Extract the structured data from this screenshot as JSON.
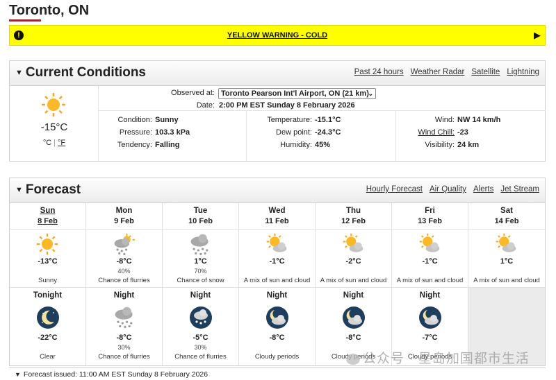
{
  "location": "Toronto, ON",
  "warning": {
    "text": "YELLOW WARNING - COLD",
    "color": "#ffff00"
  },
  "current": {
    "title": "Current Conditions",
    "links": [
      "Past 24 hours",
      "Weather Radar",
      "Satellite",
      "Lightning"
    ],
    "temp": "-15°C",
    "unit_c": "°C",
    "unit_f": "°F",
    "observed_label": "Observed at:",
    "observed_station": "Toronto Pearson Int'l Airport, ON (21 km)",
    "date_label": "Date:",
    "date": "2:00 PM EST Sunday 8 February 2026",
    "condition_label": "Condition:",
    "condition": "Sunny",
    "pressure_label": "Pressure:",
    "pressure": "103.3 kPa",
    "tendency_label": "Tendency:",
    "tendency": "Falling",
    "temperature_label": "Temperature:",
    "temperature": "-15.1°C",
    "dewpoint_label": "Dew point:",
    "dewpoint": "-24.3°C",
    "humidity_label": "Humidity:",
    "humidity": "45%",
    "wind_label": "Wind:",
    "wind": "NW 14 km/h",
    "windchill_label": "Wind Chill:",
    "windchill": "-23",
    "visibility_label": "Visibility:",
    "visibility": "24 km",
    "icon": "sun-icon"
  },
  "forecast": {
    "title": "Forecast",
    "links": [
      "Hourly Forecast",
      "Air Quality",
      "Alerts",
      "Jet Stream"
    ],
    "days": [
      {
        "name": "Sun",
        "date": "8 Feb",
        "temp": "-13°C",
        "pop": "",
        "summary": "Sunny",
        "icon": "sun-icon"
      },
      {
        "name": "Mon",
        "date": "9 Feb",
        "temp": "-8°C",
        "pop": "40%",
        "summary": "Chance of flurries",
        "icon": "sun-cloud-snow-icon"
      },
      {
        "name": "Tue",
        "date": "10 Feb",
        "temp": "1°C",
        "pop": "70%",
        "summary": "Chance of snow",
        "icon": "cloud-snow-icon"
      },
      {
        "name": "Wed",
        "date": "11 Feb",
        "temp": "-1°C",
        "pop": "",
        "summary": "A mix of sun and cloud",
        "icon": "sun-cloud-icon"
      },
      {
        "name": "Thu",
        "date": "12 Feb",
        "temp": "-2°C",
        "pop": "",
        "summary": "A mix of sun and cloud",
        "icon": "sun-cloud-icon"
      },
      {
        "name": "Fri",
        "date": "13 Feb",
        "temp": "-1°C",
        "pop": "",
        "summary": "A mix of sun and cloud",
        "icon": "sun-cloud-icon"
      },
      {
        "name": "Sat",
        "date": "14 Feb",
        "temp": "1°C",
        "pop": "",
        "summary": "A mix of sun and cloud",
        "icon": "sun-cloud-icon"
      }
    ],
    "nights": [
      {
        "name": "Tonight",
        "temp": "-22°C",
        "pop": "",
        "summary": "Clear",
        "icon": "moon-icon"
      },
      {
        "name": "Night",
        "temp": "-8°C",
        "pop": "30%",
        "summary": "Chance of flurries",
        "icon": "cloud-snow-icon"
      },
      {
        "name": "Night",
        "temp": "-5°C",
        "pop": "30%",
        "summary": "Chance of flurries",
        "icon": "moon-cloud-snow-icon"
      },
      {
        "name": "Night",
        "temp": "-8°C",
        "pop": "",
        "summary": "Cloudy periods",
        "icon": "moon-cloud-icon"
      },
      {
        "name": "Night",
        "temp": "-8°C",
        "pop": "",
        "summary": "Cloudy periods",
        "icon": "moon-cloud-icon"
      },
      {
        "name": "Night",
        "temp": "-7°C",
        "pop": "",
        "summary": "Cloudy periods",
        "icon": "moon-cloud-icon"
      }
    ]
  },
  "issued": "Forecast issued: 11:00 AM EST Sunday 8 February 2026",
  "watermark": "公众号 · 星岛加国都市生活",
  "accent_color": "#a0282b"
}
